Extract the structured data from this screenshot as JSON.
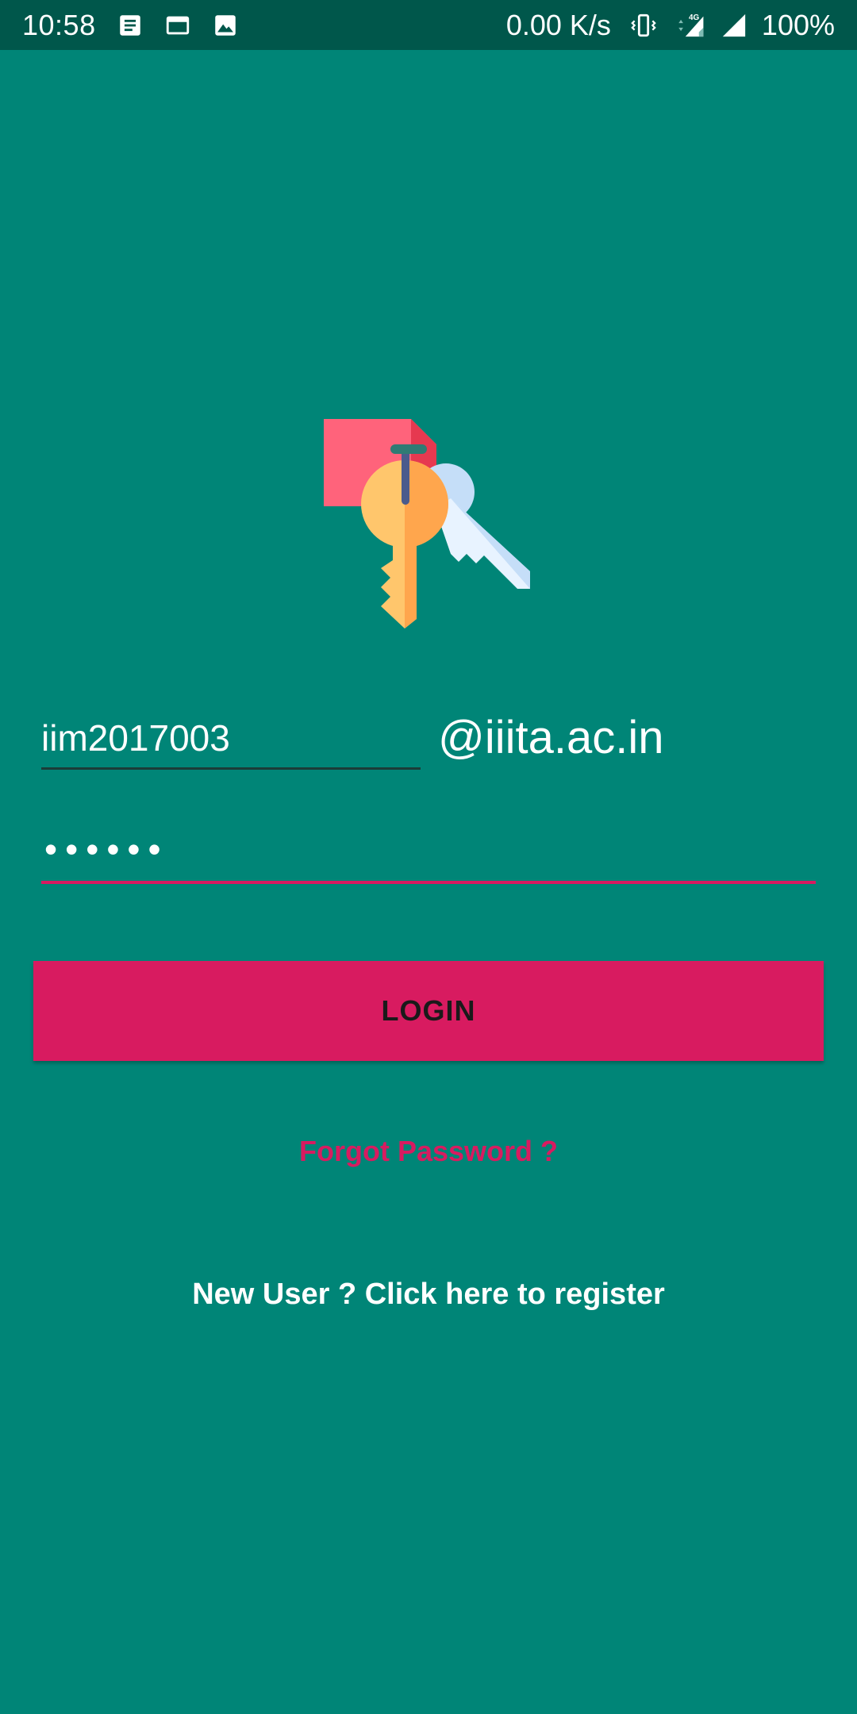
{
  "status_bar": {
    "time": "10:58",
    "net_speed": "0.00 K/s",
    "network_type": "4G",
    "battery": "100%",
    "icons": [
      "notes-icon",
      "window-icon",
      "image-icon",
      "vibrate-icon",
      "cellular-signal-icon",
      "wifi-signal-icon"
    ]
  },
  "login_form": {
    "username_value": "iim2017003",
    "domain_suffix": "@iiita.ac.in",
    "password_value": "••••••",
    "login_label": "LOGIN",
    "forgot_label": "Forgot Password ?",
    "register_label": "New User ? Click here to register"
  },
  "colors": {
    "primary": "#008577",
    "primary_dark": "#00574B",
    "accent": "#D81B60"
  },
  "logo_icon": "keys-with-tag-icon"
}
